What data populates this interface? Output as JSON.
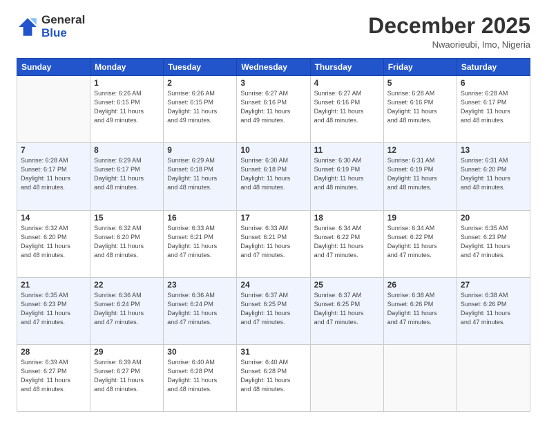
{
  "logo": {
    "general": "General",
    "blue": "Blue"
  },
  "header": {
    "month": "December 2025",
    "location": "Nwaorieubi, Imo, Nigeria"
  },
  "weekdays": [
    "Sunday",
    "Monday",
    "Tuesday",
    "Wednesday",
    "Thursday",
    "Friday",
    "Saturday"
  ],
  "weeks": [
    [
      {
        "day": "",
        "info": ""
      },
      {
        "day": "1",
        "info": "Sunrise: 6:26 AM\nSunset: 6:15 PM\nDaylight: 11 hours\nand 49 minutes."
      },
      {
        "day": "2",
        "info": "Sunrise: 6:26 AM\nSunset: 6:15 PM\nDaylight: 11 hours\nand 49 minutes."
      },
      {
        "day": "3",
        "info": "Sunrise: 6:27 AM\nSunset: 6:16 PM\nDaylight: 11 hours\nand 49 minutes."
      },
      {
        "day": "4",
        "info": "Sunrise: 6:27 AM\nSunset: 6:16 PM\nDaylight: 11 hours\nand 48 minutes."
      },
      {
        "day": "5",
        "info": "Sunrise: 6:28 AM\nSunset: 6:16 PM\nDaylight: 11 hours\nand 48 minutes."
      },
      {
        "day": "6",
        "info": "Sunrise: 6:28 AM\nSunset: 6:17 PM\nDaylight: 11 hours\nand 48 minutes."
      }
    ],
    [
      {
        "day": "7",
        "info": "Sunrise: 6:28 AM\nSunset: 6:17 PM\nDaylight: 11 hours\nand 48 minutes."
      },
      {
        "day": "8",
        "info": "Sunrise: 6:29 AM\nSunset: 6:17 PM\nDaylight: 11 hours\nand 48 minutes."
      },
      {
        "day": "9",
        "info": "Sunrise: 6:29 AM\nSunset: 6:18 PM\nDaylight: 11 hours\nand 48 minutes."
      },
      {
        "day": "10",
        "info": "Sunrise: 6:30 AM\nSunset: 6:18 PM\nDaylight: 11 hours\nand 48 minutes."
      },
      {
        "day": "11",
        "info": "Sunrise: 6:30 AM\nSunset: 6:19 PM\nDaylight: 11 hours\nand 48 minutes."
      },
      {
        "day": "12",
        "info": "Sunrise: 6:31 AM\nSunset: 6:19 PM\nDaylight: 11 hours\nand 48 minutes."
      },
      {
        "day": "13",
        "info": "Sunrise: 6:31 AM\nSunset: 6:20 PM\nDaylight: 11 hours\nand 48 minutes."
      }
    ],
    [
      {
        "day": "14",
        "info": "Sunrise: 6:32 AM\nSunset: 6:20 PM\nDaylight: 11 hours\nand 48 minutes."
      },
      {
        "day": "15",
        "info": "Sunrise: 6:32 AM\nSunset: 6:20 PM\nDaylight: 11 hours\nand 48 minutes."
      },
      {
        "day": "16",
        "info": "Sunrise: 6:33 AM\nSunset: 6:21 PM\nDaylight: 11 hours\nand 47 minutes."
      },
      {
        "day": "17",
        "info": "Sunrise: 6:33 AM\nSunset: 6:21 PM\nDaylight: 11 hours\nand 47 minutes."
      },
      {
        "day": "18",
        "info": "Sunrise: 6:34 AM\nSunset: 6:22 PM\nDaylight: 11 hours\nand 47 minutes."
      },
      {
        "day": "19",
        "info": "Sunrise: 6:34 AM\nSunset: 6:22 PM\nDaylight: 11 hours\nand 47 minutes."
      },
      {
        "day": "20",
        "info": "Sunrise: 6:35 AM\nSunset: 6:23 PM\nDaylight: 11 hours\nand 47 minutes."
      }
    ],
    [
      {
        "day": "21",
        "info": "Sunrise: 6:35 AM\nSunset: 6:23 PM\nDaylight: 11 hours\nand 47 minutes."
      },
      {
        "day": "22",
        "info": "Sunrise: 6:36 AM\nSunset: 6:24 PM\nDaylight: 11 hours\nand 47 minutes."
      },
      {
        "day": "23",
        "info": "Sunrise: 6:36 AM\nSunset: 6:24 PM\nDaylight: 11 hours\nand 47 minutes."
      },
      {
        "day": "24",
        "info": "Sunrise: 6:37 AM\nSunset: 6:25 PM\nDaylight: 11 hours\nand 47 minutes."
      },
      {
        "day": "25",
        "info": "Sunrise: 6:37 AM\nSunset: 6:25 PM\nDaylight: 11 hours\nand 47 minutes."
      },
      {
        "day": "26",
        "info": "Sunrise: 6:38 AM\nSunset: 6:26 PM\nDaylight: 11 hours\nand 47 minutes."
      },
      {
        "day": "27",
        "info": "Sunrise: 6:38 AM\nSunset: 6:26 PM\nDaylight: 11 hours\nand 47 minutes."
      }
    ],
    [
      {
        "day": "28",
        "info": "Sunrise: 6:39 AM\nSunset: 6:27 PM\nDaylight: 11 hours\nand 48 minutes."
      },
      {
        "day": "29",
        "info": "Sunrise: 6:39 AM\nSunset: 6:27 PM\nDaylight: 11 hours\nand 48 minutes."
      },
      {
        "day": "30",
        "info": "Sunrise: 6:40 AM\nSunset: 6:28 PM\nDaylight: 11 hours\nand 48 minutes."
      },
      {
        "day": "31",
        "info": "Sunrise: 6:40 AM\nSunset: 6:28 PM\nDaylight: 11 hours\nand 48 minutes."
      },
      {
        "day": "",
        "info": ""
      },
      {
        "day": "",
        "info": ""
      },
      {
        "day": "",
        "info": ""
      }
    ]
  ]
}
